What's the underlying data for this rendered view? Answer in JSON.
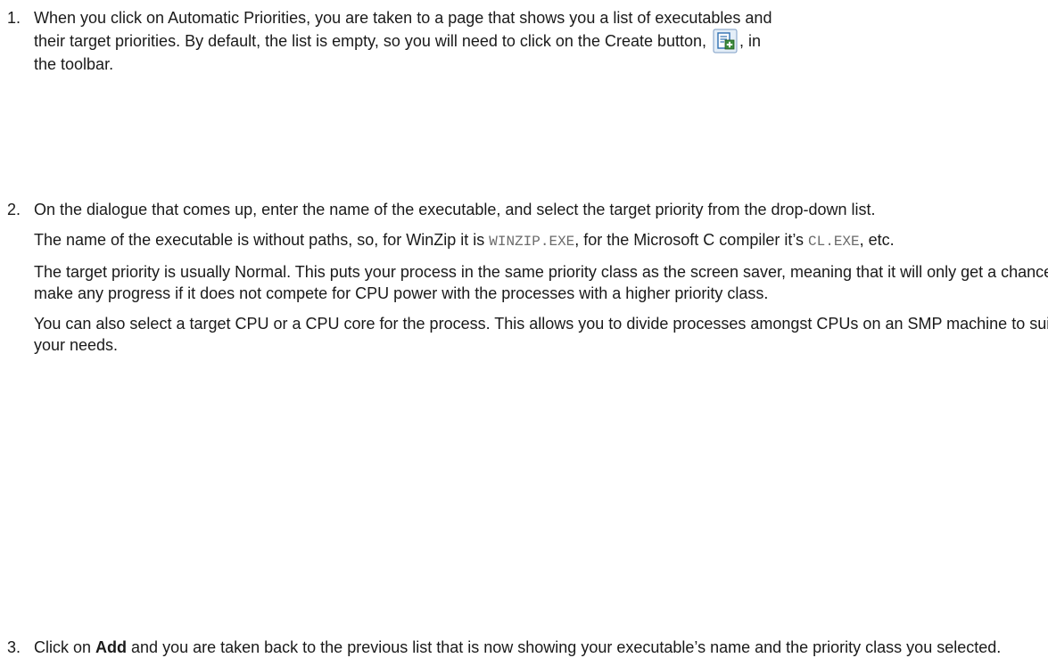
{
  "steps": [
    {
      "num": "1.",
      "line1": "When you click on Automatic Priorities, you are taken to a page that shows you a list of executables and",
      "line2_before": "their target priorities. By default, the list is empty, so you will need to click on the Create button, ",
      "line2_after": ", in",
      "line3": "the toolbar.",
      "icon": "create-icon"
    },
    {
      "num": "2.",
      "p1": "On the dialogue that comes up, enter the name of the executable, and select the target priority from the drop-down list.",
      "p2_a": "The name of the executable is without paths, so, for WinZip it is ",
      "p2_code1": "WINZIP.EXE",
      "p2_b": ", for the Microsoft C compiler it’s ",
      "p2_code2": "CL.EXE",
      "p2_c": ", etc.",
      "p3": "The target priority is usually Normal. This puts your process in the same priority class as the screen saver, meaning that it will only get a chance to make any progress if it does not compete for CPU power with the processes with a higher priority class.",
      "p4": "You can also select a target CPU or a CPU core for the process. This allows you to divide processes amongst CPUs on an SMP machine to suit your needs."
    },
    {
      "num": "3.",
      "a": "Click on ",
      "bold": "Add",
      "b": " and you are taken back to the previous list that is now showing your executable’s name and the priority class you selected."
    }
  ]
}
